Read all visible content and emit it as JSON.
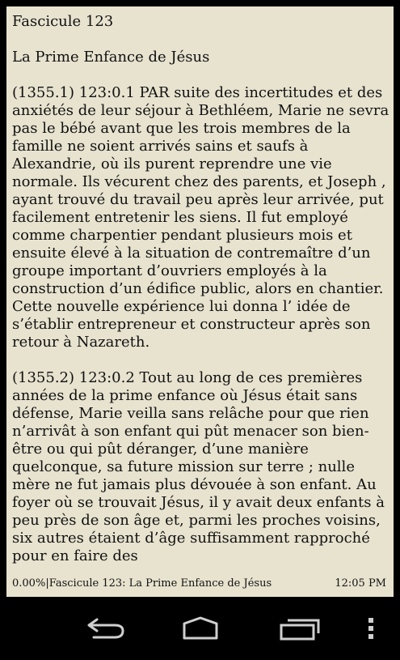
{
  "book": {
    "title": "Fascicule 123",
    "subtitle": "La Prime Enfance de Jésus",
    "paragraphs": [
      "(1355.1) 123:0.1 PAR suite des incertitudes et des anxiétés de leur séjour à Bethléem, Marie ne sevra pas le bébé avant que les trois membres de la famille ne soient arrivés sains et saufs à Alexandrie, où ils purent reprendre une vie normale. Ils vécurent chez des parents, et Joseph , ayant trouvé du travail peu après leur arrivée, put facilement entretenir les siens. Il fut employé comme charpentier pendant plusieurs mois et ensuite élevé à la situation de contremaître d’un groupe important d’ouvriers employés à la construction d’un édifice public, alors en chantier. Cette nouvelle expérience lui donna l’ idée de s’établir entrepreneur et constructeur après son retour à Nazareth.",
      "(1355.2) 123:0.2 Tout au long de ces premières années de la prime enfance où Jésus était sans défense, Marie veilla sans relâche pour que rien n’arrivât à son enfant qui pût menacer son bien-être ou qui pût déranger, d’une manière quelconque, sa future mission sur terre ; nulle mère ne fut jamais plus dévouée à son enfant. Au foyer où se trouvait Jésus, il y avait deux enfants à peu près de son âge et, parmi les proches voisins, six autres étaient d’âge suffisamment rapproché pour en faire des"
    ]
  },
  "status": {
    "progress": "0.00%",
    "separator": "|",
    "chapter": "Fascicule 123: La Prime Enfance de Jésus",
    "time": "12:05 PM"
  },
  "navbar": {
    "icons": [
      "back-icon",
      "home-icon",
      "recent-apps-icon",
      "menu-icon"
    ]
  }
}
